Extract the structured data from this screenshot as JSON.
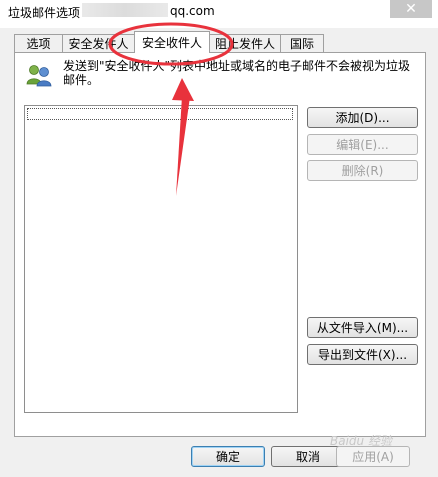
{
  "window": {
    "title": "垃圾邮件选项",
    "title_email": "qq.com",
    "close_label": "✕"
  },
  "tabs": [
    {
      "label": "选项",
      "active": false
    },
    {
      "label": "安全发件人",
      "active": false
    },
    {
      "label": "安全收件人",
      "active": true
    },
    {
      "label": "阻止发件人",
      "active": false
    },
    {
      "label": "国际",
      "active": false
    }
  ],
  "panel": {
    "description": "发送到\"安全收件人\"列表中地址或域名的电子邮件不会被视为垃圾邮件。",
    "icon": "people-icon"
  },
  "buttons": {
    "add": "添加(D)...",
    "edit": "编辑(E)...",
    "remove": "删除(R)",
    "import": "从文件导入(M)...",
    "export": "导出到文件(X)..."
  },
  "footer": {
    "ok": "确定",
    "cancel": "取消",
    "apply": "应用(A)"
  },
  "watermark": "Baidu 经验",
  "colors": {
    "annotation_red": "#e8323c",
    "disabled_text": "#a0a0a0"
  }
}
